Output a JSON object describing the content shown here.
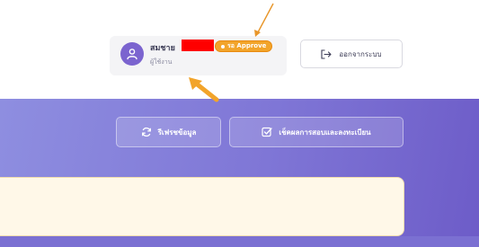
{
  "header": {
    "user": {
      "name": "สมชาย",
      "role": "ผู้ใช้งาน",
      "avatar_icon": "user-icon",
      "status_badge": "รอ Approve",
      "badge_color": "#f2a42a"
    },
    "logout": {
      "label": "ออกจากระบบ",
      "icon": "logout-icon"
    }
  },
  "actions": {
    "refresh": {
      "label": "รีเฟรชข้อมูล",
      "icon": "refresh-icon"
    },
    "check": {
      "label": "เช็คผลการสอบและลงทะเบียน",
      "icon": "checkbox-icon"
    }
  },
  "colors": {
    "banner_start": "#8e8ee0",
    "banner_end": "#6d5cc8",
    "card_bg": "#fff8e8",
    "annotation": "#f2a42a"
  },
  "annotations": {
    "pointer_icon": "arrow-pointer-icon"
  }
}
